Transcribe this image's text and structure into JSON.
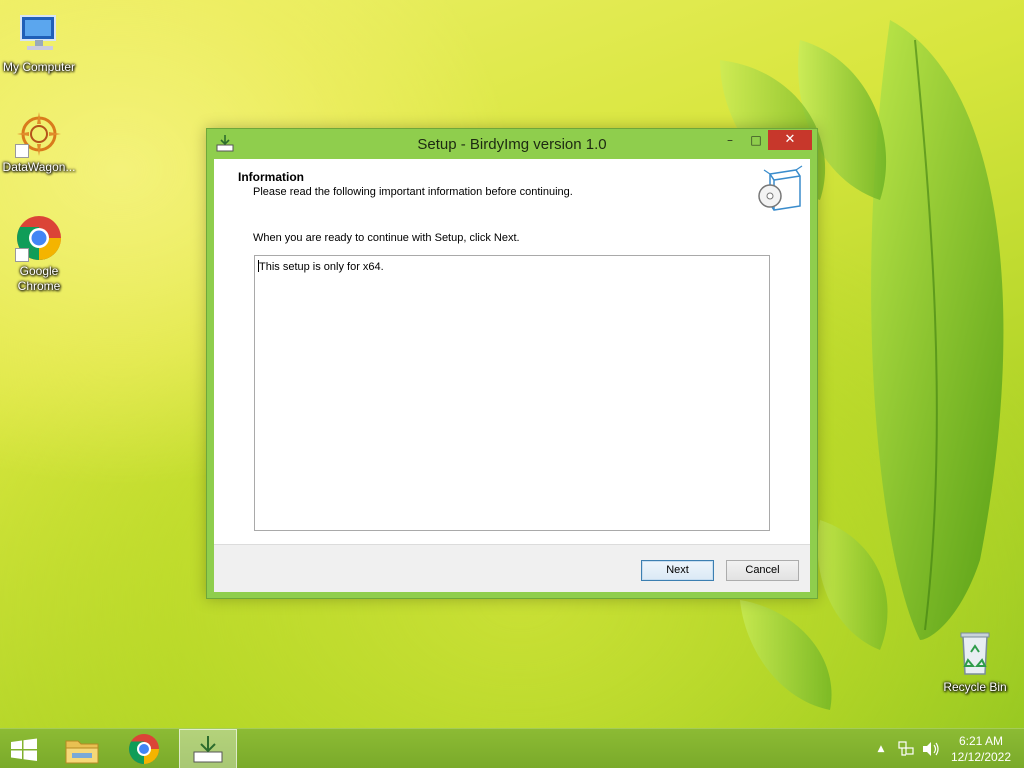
{
  "desktop": {
    "icons": [
      {
        "label": "My Computer",
        "icon": "my-computer-icon"
      },
      {
        "label": "DataWagon...",
        "icon": "datawagon-icon"
      },
      {
        "label": "Google Chrome",
        "icon": "chrome-icon"
      },
      {
        "label": "Recycle Bin",
        "icon": "recycle-bin-icon"
      }
    ]
  },
  "window": {
    "title": "Setup - BirdyImg version 1.0",
    "controls": {
      "minimize": "–",
      "maximize": "□",
      "close": "✕"
    },
    "header": {
      "title": "Information",
      "subtitle": "Please read the following important information before continuing."
    },
    "intro": "When you are ready to continue with Setup, click Next.",
    "memo": "This setup is only for x64.",
    "buttons": {
      "next": "Next",
      "cancel": "Cancel"
    }
  },
  "taskbar": {
    "items": [
      "start-icon",
      "file-explorer-icon",
      "chrome-icon",
      "setup-installer-icon"
    ],
    "tray": {
      "overflow": "▲"
    },
    "clock": {
      "time": "6:21 AM",
      "date": "12/12/2022"
    }
  },
  "colors": {
    "window_frame": "#8fce4d",
    "taskbar": "#7aaa2a",
    "close_button": "#c7372b",
    "default_button_border": "#3c7fb1"
  }
}
